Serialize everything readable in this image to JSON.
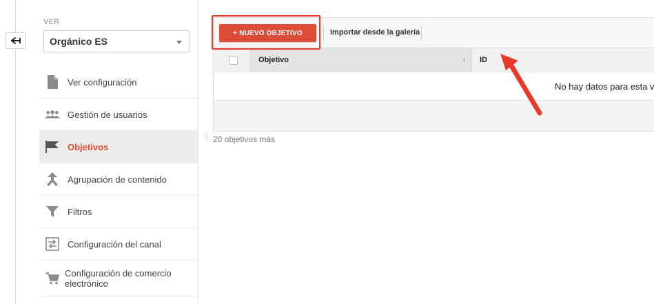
{
  "view": {
    "label": "VER",
    "selected": "Orgánico ES"
  },
  "nav": {
    "items": [
      {
        "label": "Ver configuración",
        "icon": "document-icon"
      },
      {
        "label": "Gestión de usuarios",
        "icon": "users-icon"
      },
      {
        "label": "Objetivos",
        "icon": "flag-icon",
        "active": true
      },
      {
        "label": "Agrupación de contenido",
        "icon": "content-grouping-icon"
      },
      {
        "label": "Filtros",
        "icon": "filter-icon"
      },
      {
        "label": "Configuración del canal",
        "icon": "channel-settings-icon"
      },
      {
        "label": "Configuración de comercio electrónico",
        "icon": "cart-icon"
      }
    ]
  },
  "toolbar": {
    "new_button": "+ NUEVO OBJETIVO",
    "import_link": "Importar desde la galería"
  },
  "table": {
    "columns": [
      "Objetivo",
      "ID"
    ],
    "empty_message": "No hay datos para esta vi",
    "more": "20 objetivos más"
  },
  "colors": {
    "accent": "#dd4b39",
    "active_text": "#e8492d",
    "highlight": "#e8392b"
  }
}
